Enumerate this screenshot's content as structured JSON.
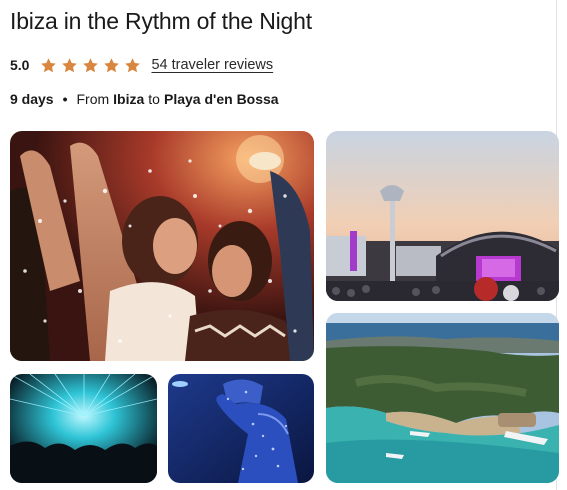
{
  "listing": {
    "title": "Ibiza in the Rythm of the Night",
    "rating": "5.0",
    "star_count": 5,
    "star_color": "#d98640",
    "reviews_label": "54 traveler reviews",
    "duration": "9 days",
    "separator": "•",
    "from_label": "From",
    "origin": "Ibiza",
    "to_label": "to",
    "destination": "Playa d'en Bossa"
  },
  "gallery": {
    "photos": [
      {
        "name": "party-crowd-photo",
        "subject": "crowd dancing under confetti"
      },
      {
        "name": "outdoor-stage-photo",
        "subject": "open-air club stage at sunset"
      },
      {
        "name": "coastline-aerial-photo",
        "subject": "aerial view of beach cove and yachts"
      },
      {
        "name": "laser-show-photo",
        "subject": "cyan laser show over crowd"
      },
      {
        "name": "sparkle-dancer-photo",
        "subject": "performer in blue sequined costume"
      }
    ]
  }
}
